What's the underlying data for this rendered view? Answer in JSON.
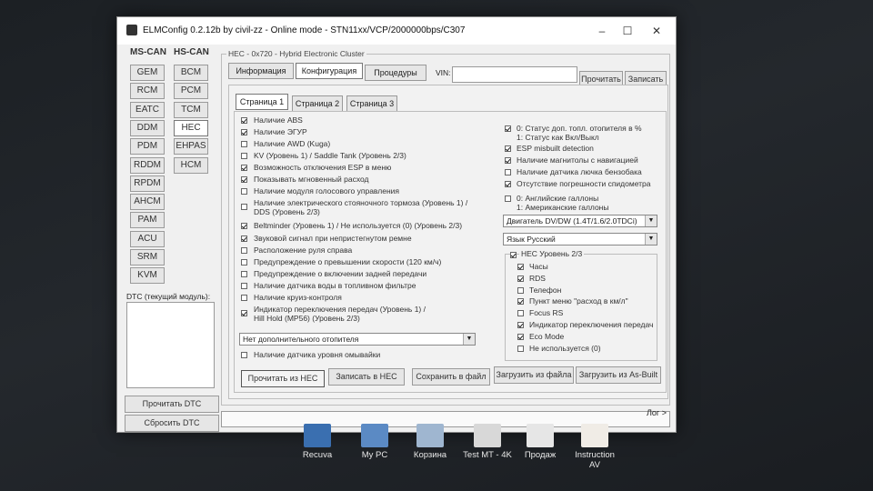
{
  "window": {
    "title": "ELMConfig 0.2.12b by civil-zz - Online mode - STN11xx/VCP/2000000bps/C307",
    "minimize": "–",
    "maximize": "☐",
    "close": "✕"
  },
  "bus_tabs": {
    "ms_can": "MS-CAN",
    "hs_can": "HS-CAN"
  },
  "ms_can_modules": [
    "GEM",
    "RCM",
    "EATC",
    "DDM",
    "PDM",
    "RDDM",
    "RPDM",
    "AHCM",
    "PAM",
    "ACU",
    "SRM",
    "KVM"
  ],
  "hs_can_modules": [
    "BCM",
    "PCM",
    "TCM",
    "HEC",
    "EHPAS",
    "HCM"
  ],
  "active_module": "HEC",
  "dtc": {
    "label": "DTC (текущий модуль):",
    "read": "Прочитать DTC",
    "reset": "Сбросить DTC"
  },
  "module_header": "HEC - 0x720 - Hybrid Electronic Cluster",
  "top_tabs": {
    "info": "Информация",
    "config": "Конфигурация",
    "procedures": "Процедуры"
  },
  "vin": {
    "label": "VIN:",
    "value": "",
    "read": "Прочитать",
    "write": "Записать"
  },
  "pages": [
    "Страница 1",
    "Страница 2",
    "Страница 3"
  ],
  "left_options": [
    {
      "label": "Наличие ABS",
      "checked": true
    },
    {
      "label": "Наличие ЭГУР",
      "checked": true
    },
    {
      "label": "Наличие AWD (Kuga)",
      "checked": false
    },
    {
      "label": "KV (Уровень 1) / Saddle Tank (Уровень 2/3)",
      "checked": false
    },
    {
      "label": "Возможность отключения ESP в меню",
      "checked": true
    },
    {
      "label": "Показывать мгновенный расход",
      "checked": true
    },
    {
      "label": "Наличие модуля голосового управления",
      "checked": false
    },
    {
      "label": "Наличие электрического стояночного тормоза (Уровень 1) /",
      "line2": "DDS (Уровень 2/3)",
      "checked": false
    },
    {
      "label": "Beltminder (Уровень 1) / Не используется (0) (Уровень 2/3)",
      "checked": true
    },
    {
      "label": "Звуковой сигнал при непристегнутом ремне",
      "checked": true
    },
    {
      "label": "Расположение руля справа",
      "checked": false
    },
    {
      "label": "Предупреждение о превышении скорости (120 км/ч)",
      "checked": false
    },
    {
      "label": "Предупреждение о включении задней передачи",
      "checked": false
    },
    {
      "label": "Наличие датчика воды в топливном фильтре",
      "checked": false
    },
    {
      "label": "Наличие круиз-контроля",
      "checked": false
    },
    {
      "label": "Индикатор переключения передач (Уровень 1) /",
      "line2": "Hill Hold (MP56) (Уровень 2/3)",
      "checked": true
    }
  ],
  "heater_select": "Нет дополнительного отопителя",
  "washer_option": {
    "label": "Наличие датчика уровня омывайки",
    "checked": false
  },
  "right_options": [
    {
      "label": "0: Статус доп. топл. отопителя в %",
      "line2": "1: Статус как Вкл/Выкл",
      "checked": true
    },
    {
      "label": "ESP misbuilt detection",
      "checked": true
    },
    {
      "label": "Наличие магнитолы с навигацией",
      "checked": true
    },
    {
      "label": "Наличие датчика лючка бензобака",
      "checked": false
    },
    {
      "label": "Отсутствие погрешности спидометра",
      "checked": true
    },
    {
      "label": "0: Английские галлоны",
      "line2": "1: Американские галлоны",
      "checked": false
    }
  ],
  "engine_select": "Двигатель DV/DW (1.4T/1.6/2.0TDCi)",
  "language_select": "Язык Русский",
  "hec_group": {
    "label": "HEC Уровень 2/3",
    "checked": true,
    "items": [
      {
        "label": "Часы",
        "checked": true
      },
      {
        "label": "RDS",
        "checked": true
      },
      {
        "label": "Телефон",
        "checked": false
      },
      {
        "label": "Пункт меню \"расход в км/л\"",
        "checked": true
      },
      {
        "label": "Focus RS",
        "checked": false
      },
      {
        "label": "Индикатор переключения передач",
        "checked": true
      },
      {
        "label": "Eco Mode",
        "checked": true
      },
      {
        "label": "Не используется (0)",
        "checked": false
      }
    ]
  },
  "bottom_buttons": {
    "read_hec": "Прочитать из HEC",
    "write_hec": "Записать в HEC",
    "save_file": "Сохранить в файл",
    "load_file": "Загрузить из файла",
    "load_asbuilt": "Загрузить из As-Built"
  },
  "log_button": "Лог >",
  "taskbar": [
    "Recuva",
    "My PC",
    "Корзина",
    "Test MT - 4K",
    "Продаж",
    "Instruction AV"
  ]
}
